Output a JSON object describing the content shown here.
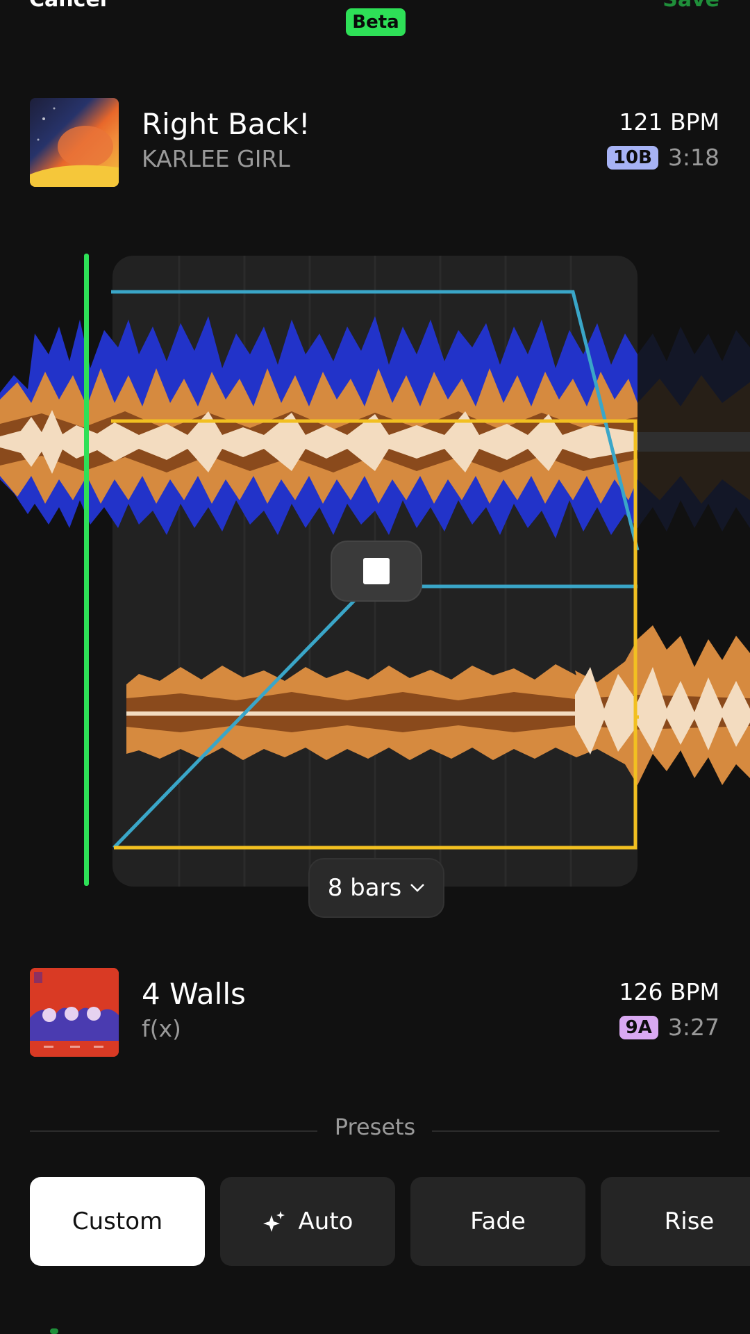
{
  "header": {
    "cancel_label": "Cancel",
    "beta_label": "Beta",
    "save_label": "Save"
  },
  "track_a": {
    "title": "Right Back!",
    "artist": "KARLEE GIRL",
    "bpm": "121 BPM",
    "key": "10B",
    "key_color": "#a7b3f5",
    "duration": "3:18"
  },
  "track_b": {
    "title": "4 Walls",
    "artist": "f(x)",
    "bpm": "126 BPM",
    "key": "9A",
    "key_color": "#d9a9f2",
    "duration": "3:27"
  },
  "transition": {
    "length_label": "8 bars",
    "playhead_color": "#2ee057",
    "volume_curve_color": "#3aa6c8",
    "eq_curve_color": "#f2c021"
  },
  "presets": {
    "heading": "Presets",
    "items": [
      {
        "label": "Custom",
        "selected": true
      },
      {
        "label": "Auto",
        "icon": "sparkle-icon",
        "selected": false
      },
      {
        "label": "Fade",
        "selected": false
      },
      {
        "label": "Rise",
        "selected": false
      }
    ]
  }
}
